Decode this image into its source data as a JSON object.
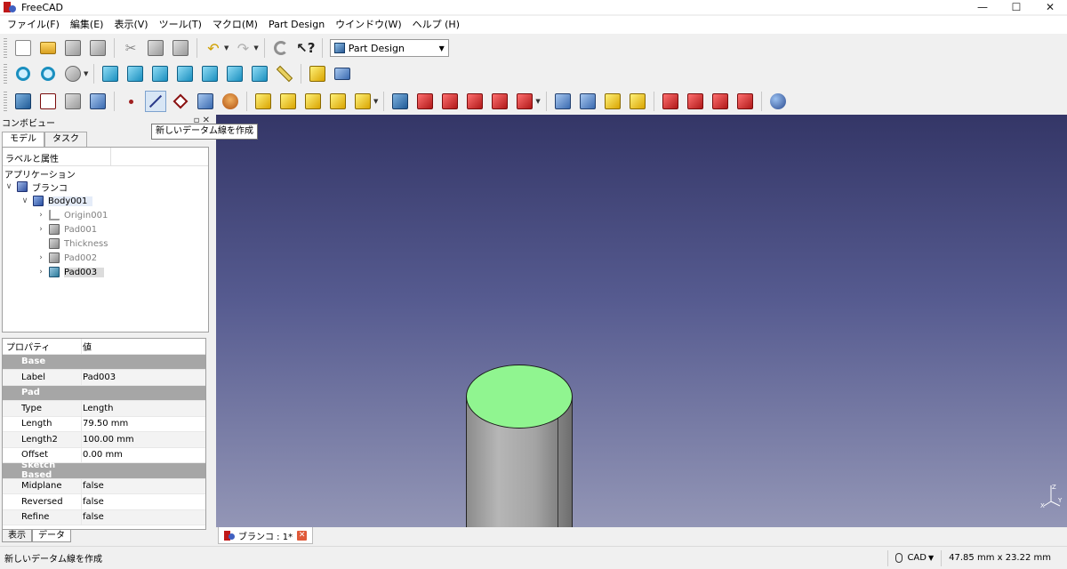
{
  "window": {
    "title": "FreeCAD"
  },
  "menu": [
    "ファイル(F)",
    "編集(E)",
    "表示(V)",
    "ツール(T)",
    "マクロ(M)",
    "Part Design",
    "ウインドウ(W)",
    "ヘルプ (H)"
  ],
  "workbench": {
    "selected": "Part Design"
  },
  "tooltip": "新しいデータム線を作成",
  "combo_view": {
    "title": "コンボビュー",
    "tabs": [
      "モデル",
      "タスク"
    ],
    "tree_header": "ラベルと属性",
    "application_label": "アプリケーション",
    "document": "ブランコ",
    "body": "Body001",
    "children": [
      "Origin001",
      "Pad001",
      "Thickness",
      "Pad002",
      "Pad003"
    ]
  },
  "properties": {
    "col_property": "プロパティ",
    "col_value": "値",
    "rows": [
      {
        "kind": "group",
        "key": "Base",
        "value": ""
      },
      {
        "kind": "item",
        "key": "Label",
        "value": "Pad003"
      },
      {
        "kind": "group",
        "key": "Pad",
        "value": ""
      },
      {
        "kind": "item",
        "key": "Type",
        "value": "Length"
      },
      {
        "kind": "item",
        "key": "Length",
        "value": "79.50 mm"
      },
      {
        "kind": "item",
        "key": "Length2",
        "value": "100.00 mm"
      },
      {
        "kind": "item",
        "key": "Offset",
        "value": "0.00 mm"
      },
      {
        "kind": "group",
        "key": "Sketch Based",
        "value": ""
      },
      {
        "kind": "item",
        "key": "Midplane",
        "value": "false"
      },
      {
        "kind": "item",
        "key": "Reversed",
        "value": "false"
      },
      {
        "kind": "item",
        "key": "Refine",
        "value": "false"
      }
    ],
    "bottom_tabs": [
      "表示",
      "データ"
    ]
  },
  "document_tab": {
    "label": "ブランコ : 1*"
  },
  "status": {
    "message": "新しいデータム線を作成",
    "navigation": "CAD",
    "dimensions": "47.85 mm x 23.22 mm"
  },
  "colors": {
    "face_top": "#90f590",
    "viewport_top": "#343667",
    "viewport_bottom": "#9396b6"
  }
}
